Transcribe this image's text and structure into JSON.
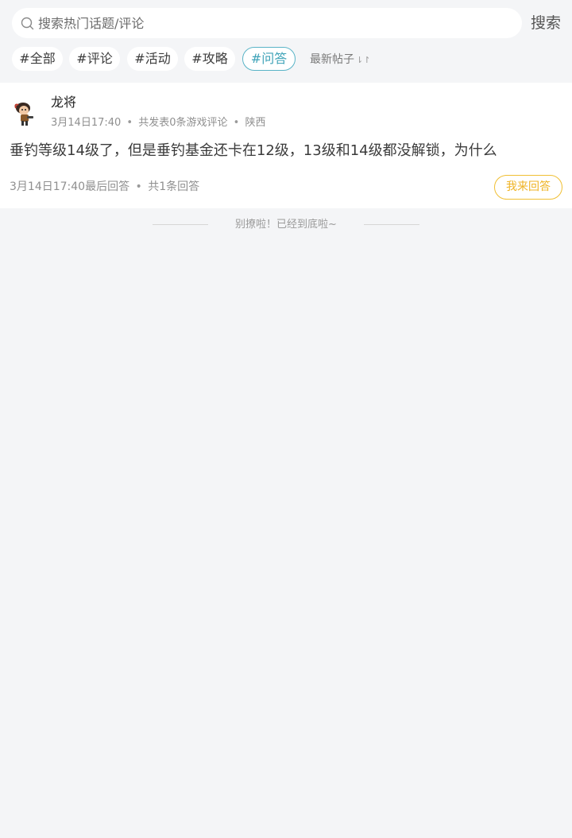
{
  "search": {
    "placeholder": "搜索热门话题/评论",
    "value": "",
    "button_label": "搜索"
  },
  "tags": [
    {
      "label": "#全部",
      "active": false
    },
    {
      "label": "#评论",
      "active": false
    },
    {
      "label": "#活动",
      "active": false
    },
    {
      "label": "#攻略",
      "active": false
    },
    {
      "label": "#问答",
      "active": true
    }
  ],
  "sort": {
    "label": "最新帖子",
    "icon": "sort-arrows-icon"
  },
  "posts": [
    {
      "author": "龙将",
      "time": "3月14日17:40",
      "review_count": "共发表0条游戏评论",
      "location": "陕西",
      "content": "垂钓等级14级了，但是垂钓基金还卡在12级，13级和14级都没解锁，为什么",
      "last_reply": "3月14日17:40最后回答",
      "answer_count": "共1条回答",
      "answer_button": "我来回答"
    }
  ],
  "list_end": {
    "text": "别撩啦！已经到底啦~"
  },
  "colors": {
    "background": "#f4f5f7",
    "active_tag": "#3fa3b8",
    "answer_button": "#efb324"
  }
}
